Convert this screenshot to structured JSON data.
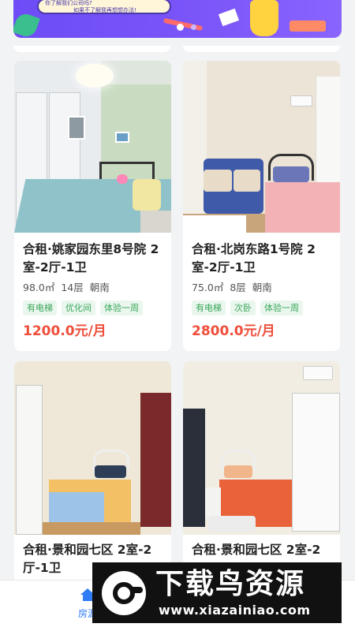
{
  "banner": {
    "text_line1": "你了解我们公司吗?",
    "text_line2": "如果不了解我再想想办法!"
  },
  "listings": [
    {
      "title": "合租·姚家园东里8号院 2室-2厅-1卫",
      "area": "98.0㎡",
      "floor": "14层",
      "orientation": "朝南",
      "tags": [
        "有电梯",
        "优化间",
        "体验一周"
      ],
      "price": "1200.0元/月"
    },
    {
      "title": "合租·北岗东路1号院 2室-2厅-1卫",
      "area": "75.0㎡",
      "floor": "8层",
      "orientation": "朝南",
      "tags": [
        "有电梯",
        "次卧",
        "体验一周"
      ],
      "price": "2800.0元/月"
    },
    {
      "title": "合租·景和园七区 2室-2厅-1卫"
    },
    {
      "title": "合租·景和园七区 2室-2"
    }
  ],
  "tabbar": {
    "home_label": "房源"
  },
  "watermark": {
    "logo_text": "下载鸟资源",
    "url": "www.xiazainiao.com"
  }
}
